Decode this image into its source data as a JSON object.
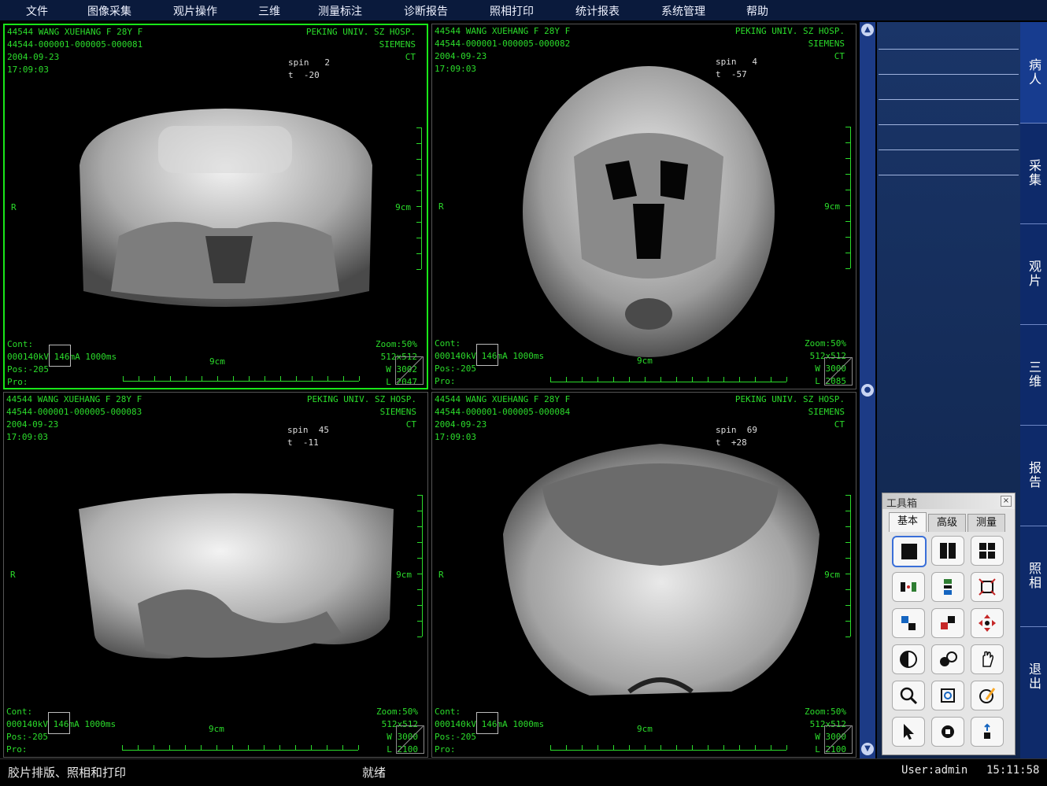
{
  "menu": [
    "文件",
    "图像采集",
    "观片操作",
    "三维",
    "测量标注",
    "诊断报告",
    "照相打印",
    "统计报表",
    "系统管理",
    "帮助"
  ],
  "viewports": [
    {
      "patient": "44544 WANG XUEHANG F 28Y F",
      "series": "44544-000001-000005-000081",
      "date": "2004-09-23",
      "time": "17:09:03",
      "hospital": "PEKING UNIV. SZ HOSP.",
      "maker": "SIEMENS",
      "modality": "CT",
      "spin": "spin   2",
      "tilt": "t  -20",
      "side": "R",
      "scale": "9cm",
      "cont": "Cont:",
      "kv": "000140kV 146mA 1000ms",
      "pos": "Pos:-205",
      "pro": "Pro:",
      "zoom": "Zoom:50%",
      "matrix": "512x512",
      "w": "W 3002",
      "l": "L 2047"
    },
    {
      "patient": "44544 WANG XUEHANG F 28Y F",
      "series": "44544-000001-000005-000082",
      "date": "2004-09-23",
      "time": "17:09:03",
      "hospital": "PEKING UNIV. SZ HOSP.",
      "maker": "SIEMENS",
      "modality": "CT",
      "spin": "spin   4",
      "tilt": "t  -57",
      "side": "R",
      "scale": "9cm",
      "cont": "Cont:",
      "kv": "000140kV 146mA 1000ms",
      "pos": "Pos:-205",
      "pro": "Pro:",
      "zoom": "Zoom:50%",
      "matrix": "512x512",
      "w": "W 3000",
      "l": "L 2085"
    },
    {
      "patient": "44544 WANG XUEHANG F 28Y F",
      "series": "44544-000001-000005-000083",
      "date": "2004-09-23",
      "time": "17:09:03",
      "hospital": "PEKING UNIV. SZ HOSP.",
      "maker": "SIEMENS",
      "modality": "CT",
      "spin": "spin  45",
      "tilt": "t  -11",
      "side": "R",
      "scale": "9cm",
      "cont": "Cont:",
      "kv": "000140kV 146mA 1000ms",
      "pos": "Pos:-205",
      "pro": "Pro:",
      "zoom": "Zoom:50%",
      "matrix": "512x512",
      "w": "W 3000",
      "l": "L 2100"
    },
    {
      "patient": "44544 WANG XUEHANG F 28Y F",
      "series": "44544-000001-000005-000084",
      "date": "2004-09-23",
      "time": "17:09:03",
      "hospital": "PEKING UNIV. SZ HOSP.",
      "maker": "SIEMENS",
      "modality": "CT",
      "spin": "spin  69",
      "tilt": "t  +28",
      "side": "R",
      "scale": "9cm",
      "cont": "Cont:",
      "kv": "000140kV 146mA 1000ms",
      "pos": "Pos:-205",
      "pro": "Pro:",
      "zoom": "Zoom:50%",
      "matrix": "512x512",
      "w": "W 3000",
      "l": "L 2100"
    }
  ],
  "nav_tabs": [
    "病人",
    "采集",
    "观片",
    "三维",
    "报告",
    "照相",
    "退出"
  ],
  "toolbox": {
    "title": "工具箱",
    "close": "×",
    "tabs": [
      "基本",
      "高级",
      "测量"
    ]
  },
  "tools": [
    "layout-1x1",
    "layout-1x2",
    "layout-2x2",
    "compare",
    "series-stack",
    "fit-window",
    "flip",
    "swap",
    "pan-cross",
    "invert",
    "window-level",
    "hand-pan",
    "magnify",
    "crop-zoom",
    "annotate",
    "pointer",
    "stop",
    "reset"
  ],
  "status": {
    "left": "胶片排版、照相和打印",
    "center": "就绪",
    "user": "User:admin",
    "time": "15:11:58"
  }
}
